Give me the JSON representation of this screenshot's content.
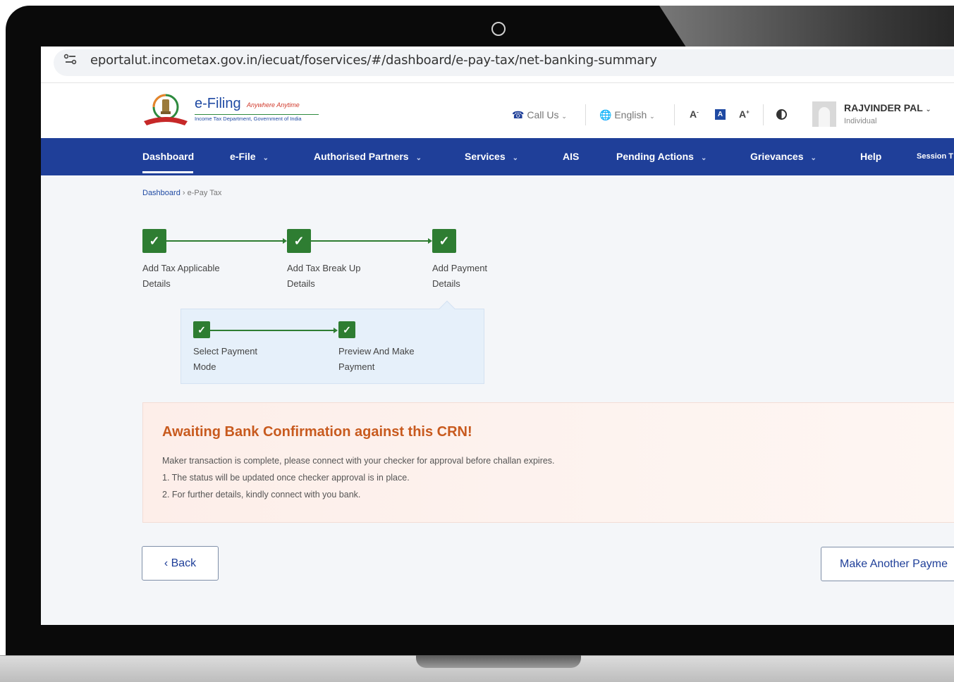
{
  "browser": {
    "url": "eportalut.incometax.gov.in/iecuat/foservices/#/dashboard/e-pay-tax/net-banking-summary"
  },
  "header": {
    "logo_title": "e-Filing",
    "logo_tagline": "Anywhere Anytime",
    "logo_subtitle": "Income Tax Department, Government of India",
    "call_us": "Call Us",
    "language": "English",
    "font_decrease": "A",
    "font_normal": "A",
    "font_increase": "A",
    "user_name": "RAJVINDER PAL",
    "user_role": "Individual"
  },
  "nav": {
    "items": [
      "Dashboard",
      "e-File",
      "Authorised Partners",
      "Services",
      "AIS",
      "Pending Actions",
      "Grievances",
      "Help",
      "Session T"
    ]
  },
  "breadcrumb": {
    "root": "Dashboard",
    "current": "e-Pay Tax"
  },
  "steps": [
    {
      "line1": "Add Tax Applicable",
      "line2": "Details"
    },
    {
      "line1": "Add Tax Break Up",
      "line2": "Details"
    },
    {
      "line1": "Add Payment",
      "line2": "Details"
    }
  ],
  "substeps": [
    {
      "line1": "Select Payment",
      "line2": "Mode"
    },
    {
      "line1": "Preview And Make",
      "line2": "Payment"
    }
  ],
  "alert": {
    "title": "Awaiting Bank Confirmation against this CRN!",
    "message": "Maker transaction is complete, please connect with your checker for approval before challan expires.",
    "point1": "1. The status will be updated once checker approval is in place.",
    "point2": "2. For further details, kindly connect with you bank."
  },
  "buttons": {
    "back": "Back",
    "make_another": "Make Another Payme"
  },
  "colors": {
    "nav_bg": "#1f3f99",
    "step_green": "#2e7d32",
    "alert_title": "#c85a1e"
  }
}
